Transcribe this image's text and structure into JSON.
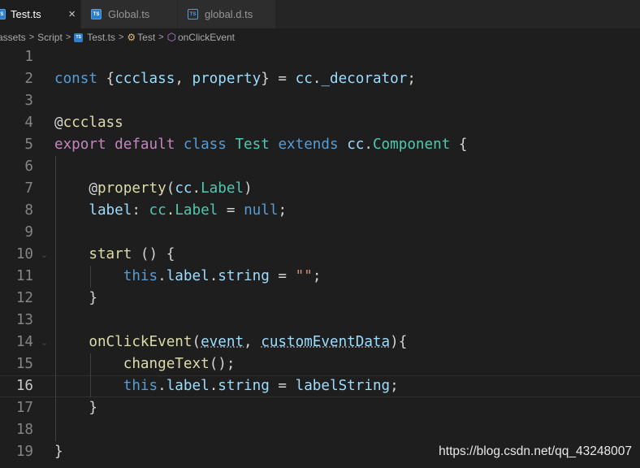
{
  "tabs": [
    {
      "label": "Test.ts",
      "icon": "ts-file-icon",
      "active": true,
      "close": "×"
    },
    {
      "label": "Global.ts",
      "icon": "ts-file-icon",
      "active": false
    },
    {
      "label": "global.d.ts",
      "icon": "ts-declaration-icon",
      "active": false
    }
  ],
  "ts_badge": "TS",
  "breadcrumb": {
    "items": [
      "assets",
      "Script",
      "Test.ts",
      "Test",
      "onClickEvent"
    ],
    "separator": ">"
  },
  "editor": {
    "current_line": 16,
    "line_numbers": [
      "1",
      "2",
      "3",
      "4",
      "5",
      "6",
      "7",
      "8",
      "9",
      "10",
      "11",
      "12",
      "13",
      "14",
      "15",
      "16",
      "17",
      "18",
      "19"
    ],
    "lines": [
      [],
      [
        [
          "kw",
          "const"
        ],
        [
          "pl",
          " {"
        ],
        [
          "var",
          "ccclass"
        ],
        [
          "pl",
          ", "
        ],
        [
          "var",
          "property"
        ],
        [
          "pl",
          "} = "
        ],
        [
          "var",
          "cc"
        ],
        [
          "pl",
          "."
        ],
        [
          "var",
          "_decorator"
        ],
        [
          "pl",
          ";"
        ]
      ],
      [],
      [
        [
          "pl",
          "@"
        ],
        [
          "fn",
          "ccclass"
        ]
      ],
      [
        [
          "ctl",
          "export"
        ],
        [
          "pl",
          " "
        ],
        [
          "ctl",
          "default"
        ],
        [
          "pl",
          " "
        ],
        [
          "kw",
          "class"
        ],
        [
          "pl",
          " "
        ],
        [
          "type",
          "Test"
        ],
        [
          "pl",
          " "
        ],
        [
          "kw",
          "extends"
        ],
        [
          "pl",
          " "
        ],
        [
          "var",
          "cc"
        ],
        [
          "pl",
          "."
        ],
        [
          "type",
          "Component"
        ],
        [
          "pl",
          " {"
        ]
      ],
      [],
      [
        [
          "pl",
          "    @"
        ],
        [
          "fn",
          "property"
        ],
        [
          "pl",
          "("
        ],
        [
          "var",
          "cc"
        ],
        [
          "pl",
          "."
        ],
        [
          "type",
          "Label"
        ],
        [
          "pl",
          ")"
        ]
      ],
      [
        [
          "pl",
          "    "
        ],
        [
          "var",
          "label"
        ],
        [
          "pl",
          ": "
        ],
        [
          "type",
          "cc"
        ],
        [
          "pl",
          "."
        ],
        [
          "type",
          "Label"
        ],
        [
          "pl",
          " = "
        ],
        [
          "kw",
          "null"
        ],
        [
          "pl",
          ";"
        ]
      ],
      [],
      [
        [
          "pl",
          "    "
        ],
        [
          "fn",
          "start"
        ],
        [
          "pl",
          " () {"
        ]
      ],
      [
        [
          "pl",
          "        "
        ],
        [
          "kw",
          "this"
        ],
        [
          "pl",
          "."
        ],
        [
          "var",
          "label"
        ],
        [
          "pl",
          "."
        ],
        [
          "var",
          "string"
        ],
        [
          "pl",
          " = "
        ],
        [
          "str",
          "\"\""
        ],
        [
          "pl",
          ";"
        ]
      ],
      [
        [
          "pl",
          "    }"
        ]
      ],
      [],
      [
        [
          "pl",
          "    "
        ],
        [
          "fn",
          "onClickEvent"
        ],
        [
          "pl",
          "("
        ],
        [
          "var",
          "event"
        ],
        [
          "pl",
          ", "
        ],
        [
          "var",
          "customEventData"
        ],
        [
          "pl",
          "){"
        ]
      ],
      [
        [
          "pl",
          "        "
        ],
        [
          "fn",
          "changeText"
        ],
        [
          "pl",
          "();"
        ]
      ],
      [
        [
          "pl",
          "        "
        ],
        [
          "kw",
          "this"
        ],
        [
          "pl",
          "."
        ],
        [
          "var",
          "label"
        ],
        [
          "pl",
          "."
        ],
        [
          "var",
          "string"
        ],
        [
          "pl",
          " = "
        ],
        [
          "var",
          "labelString"
        ],
        [
          "pl",
          ";"
        ]
      ],
      [
        [
          "pl",
          "    }"
        ]
      ],
      [],
      [
        [
          "pl",
          "}"
        ]
      ]
    ],
    "fold_markers": [
      10,
      14
    ]
  },
  "watermark": "https://blog.csdn.net/qq_43248007",
  "colors": {
    "background": "#1e1e1e",
    "keyword": "#569cd6",
    "control": "#c586c0",
    "variable": "#9cdcfe",
    "function": "#dcdcaa",
    "type": "#4ec9b0",
    "string": "#ce9178"
  }
}
